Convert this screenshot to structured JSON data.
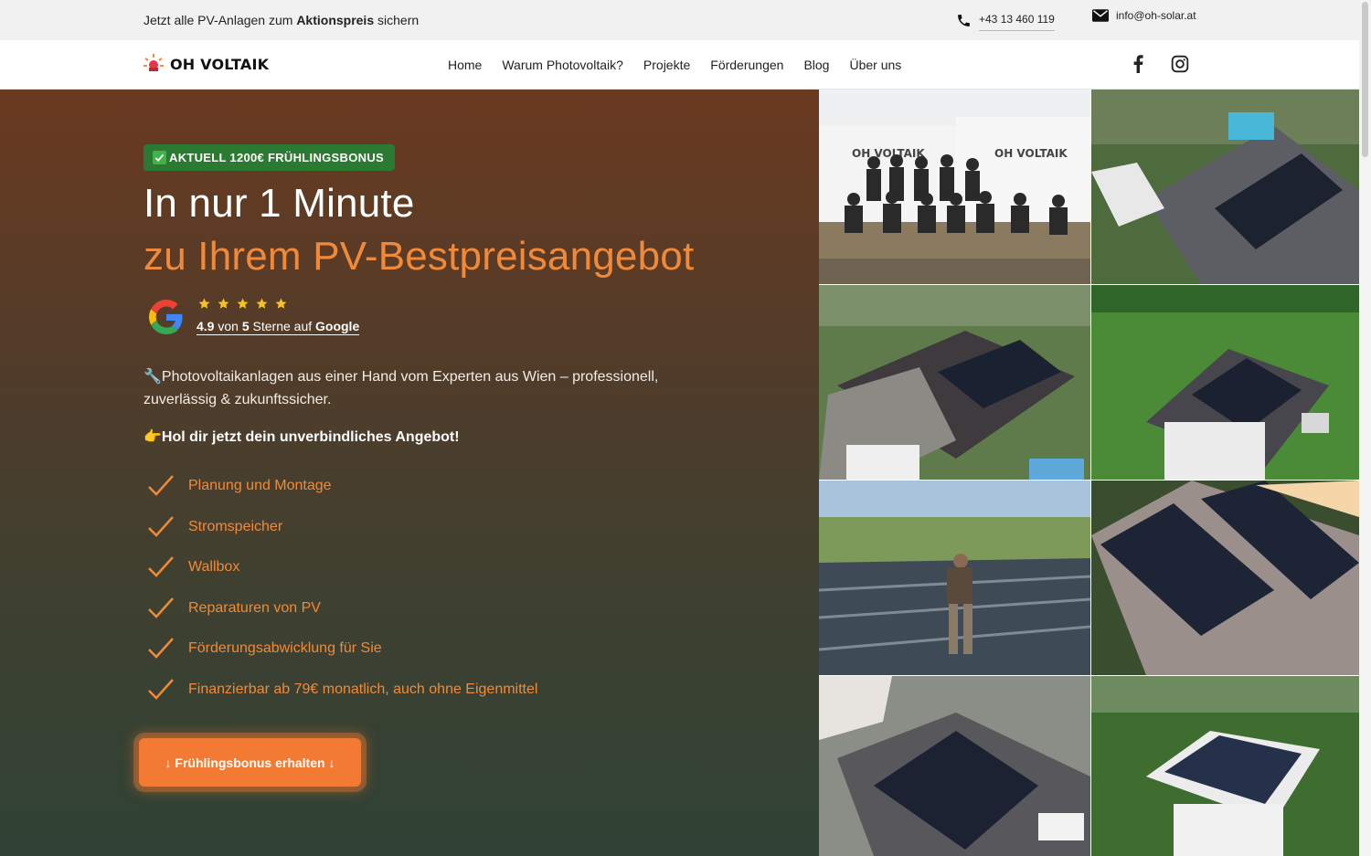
{
  "topbar": {
    "promo_pre": "Jetzt alle PV-Anlagen zum ",
    "promo_bold": "Aktionspreis",
    "promo_post": " sichern",
    "phone": "+43 13 460 119",
    "email": "info@oh-solar.at"
  },
  "nav": {
    "logo_text": "OH VOLTAIK",
    "items": [
      "Home",
      "Warum Photovoltaik?",
      "Projekte",
      "Förderungen",
      "Blog",
      "Über uns"
    ],
    "social": [
      "facebook-icon",
      "instagram-icon"
    ]
  },
  "hero": {
    "badge": "AKTUELL 1200€ FRÜHLINGSBONUS",
    "title_line1": "In nur 1 Minute",
    "title_line2": "zu Ihrem PV-Bestpreisangebot",
    "rating": {
      "stars": 5,
      "score": "4.9",
      "von": " von ",
      "max": "5",
      "mid": " Sterne auf ",
      "source": "Google"
    },
    "description": "🔧Photovoltaikanlagen aus einer Hand vom Experten aus Wien – professionell, zuverlässig & zukunftssicher.",
    "cta_text": "👉Hol dir jetzt dein unverbindliches Angebot!",
    "features": [
      "Planung und Montage",
      "Stromspeicher",
      "Wallbox",
      "Reparaturen von PV",
      "Förderungsabwicklung für Sie",
      "Finanzierbar ab 79€ monatlich, auch ohne Eigenmittel"
    ],
    "button_label": "↓ Frühlingsbonus erhalten ↓"
  },
  "gallery": {
    "van_logo_left": "OH VOLTAIK",
    "van_logo_right": "OH VOLTAIK"
  },
  "colors": {
    "accent": "#f08a3a",
    "button": "#f37a33",
    "badge": "#2a7a32"
  }
}
